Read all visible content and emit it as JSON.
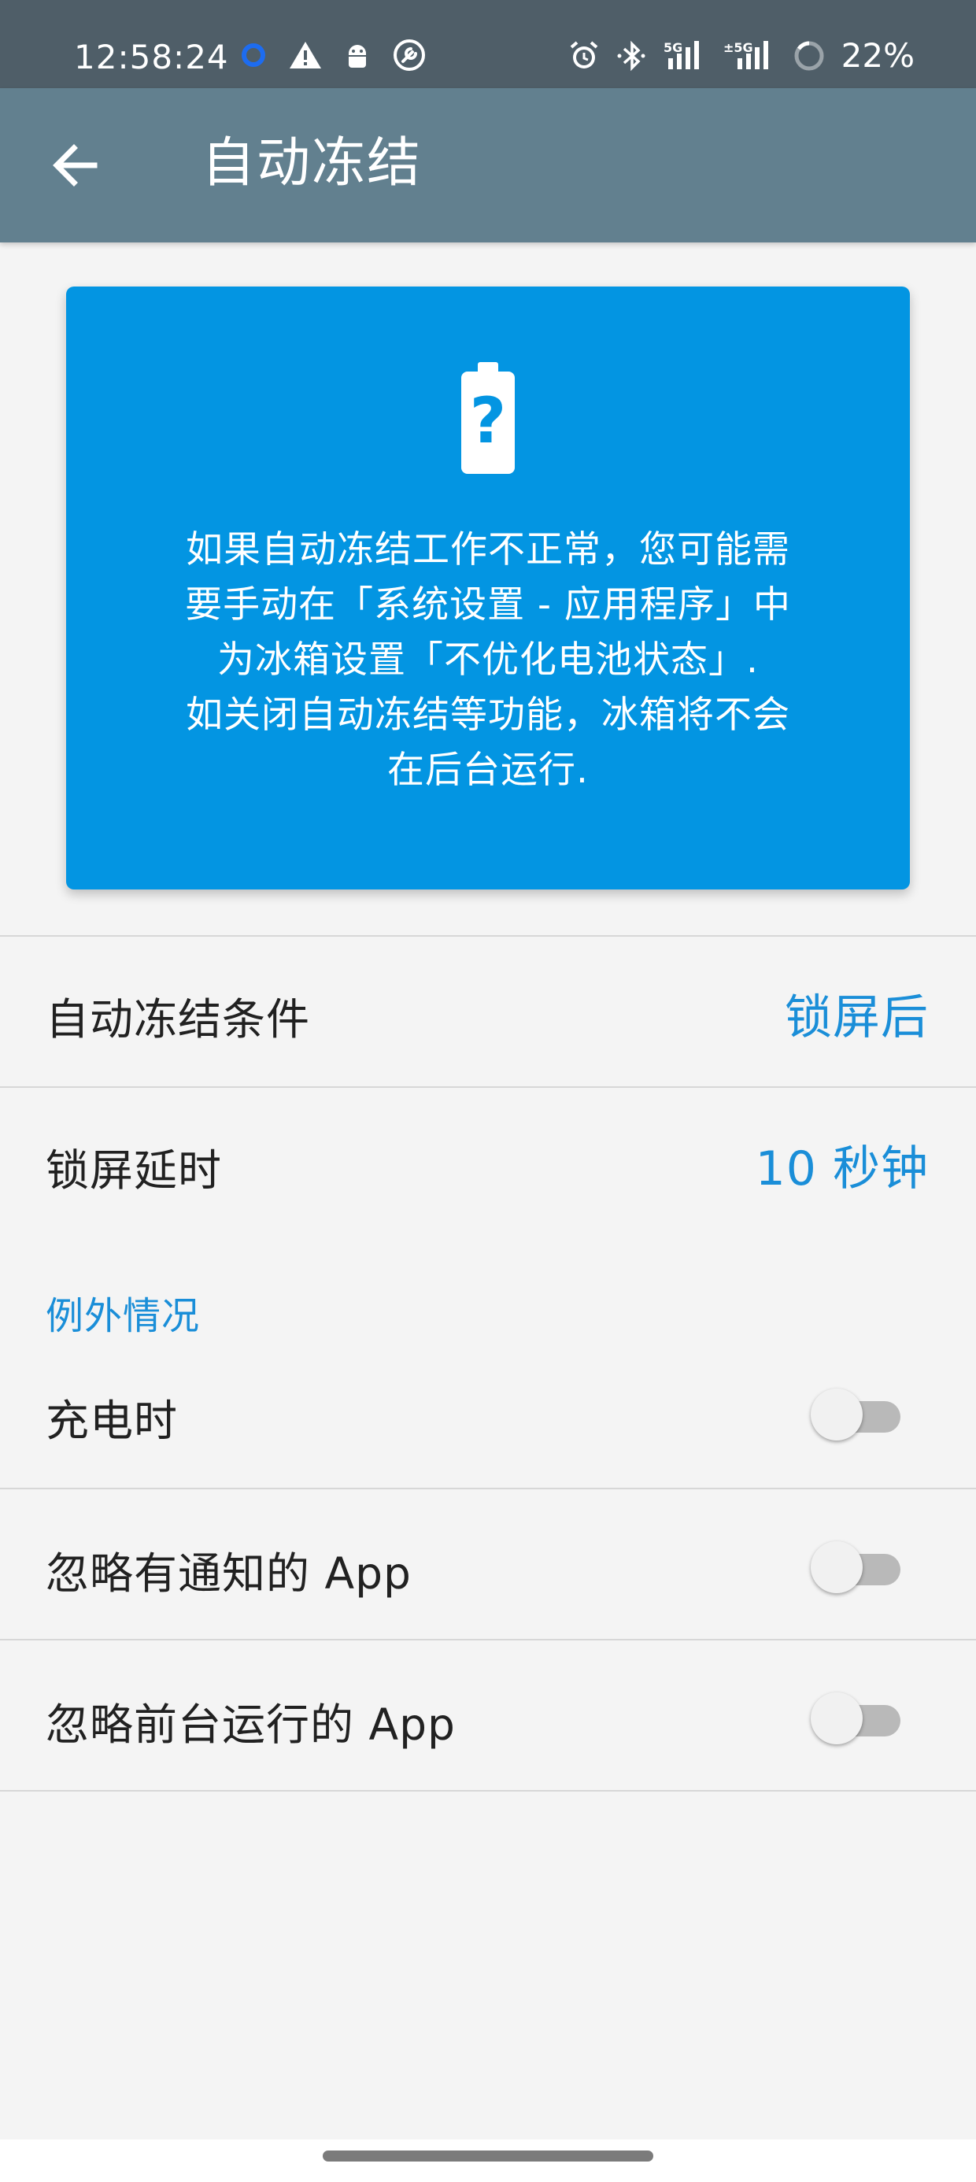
{
  "status_bar": {
    "time": "12:58:24",
    "battery_percent": "22%",
    "left_icons": [
      "circle-notification-icon",
      "warning-icon",
      "android-debug-icon",
      "wrench-icon"
    ],
    "right_icons": [
      "alarm-icon",
      "bluetooth-icon",
      "signal-5g-icon",
      "signal-5g-2-icon",
      "battery-ring-icon"
    ]
  },
  "toolbar": {
    "title": "自动冻结",
    "back_icon": "arrow-back-icon"
  },
  "info_card": {
    "icon": "battery-question-icon",
    "lines": [
      "如果自动冻结工作不正常，您可能需",
      "要手动在「系统设置 - 应用程序」中",
      "为冰箱设置「不优化电池状态」.",
      "如关闭自动冻结等功能，冰箱将不会",
      "在后台运行."
    ]
  },
  "settings": {
    "freeze_condition": {
      "label": "自动冻结条件",
      "value": "锁屏后"
    },
    "lock_delay": {
      "label": "锁屏延时",
      "value": "10 秒钟"
    },
    "exceptions_header": "例外情况",
    "toggles": [
      {
        "label": "充电时",
        "enabled": false
      },
      {
        "label": "忽略有通知的 App",
        "enabled": false
      },
      {
        "label": "忽略前台运行的 App",
        "enabled": false
      }
    ]
  },
  "colors": {
    "status_bar": "#4f5e68",
    "toolbar": "#62808f",
    "card": "#0395e2",
    "accent": "#1a8ed8",
    "background": "#f4f4f4"
  }
}
